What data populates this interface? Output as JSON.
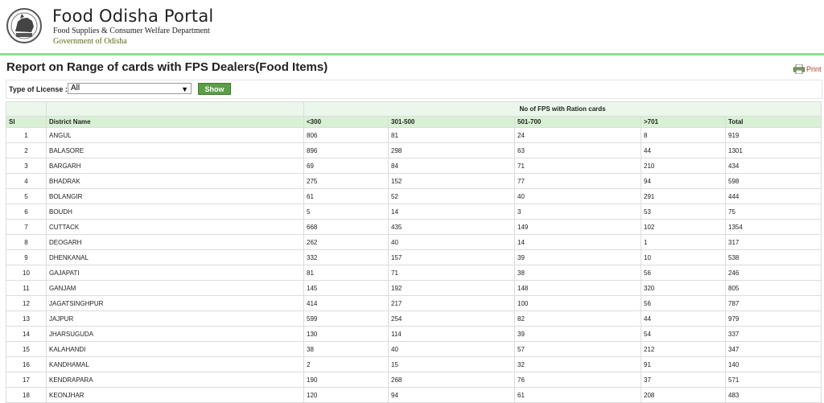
{
  "header": {
    "portal_title": "Food Odisha Portal",
    "department": "Food Supplies & Consumer Welfare Department",
    "government": "Government of Odisha"
  },
  "report": {
    "title": "Report on Range of cards with FPS Dealers(Food Items)",
    "print_label": "Print"
  },
  "filter": {
    "label": "Type of License :",
    "selected": "All",
    "show_label": "Show"
  },
  "table": {
    "group_header": "No of FPS with Ration cards",
    "columns": [
      "Sl",
      "District Name",
      "<300",
      "301-500",
      "501-700",
      ">701",
      "Total"
    ],
    "rows": [
      [
        "1",
        "ANGUL",
        "806",
        "81",
        "24",
        "8",
        "919"
      ],
      [
        "2",
        "BALASORE",
        "896",
        "298",
        "63",
        "44",
        "1301"
      ],
      [
        "3",
        "BARGARH",
        "69",
        "84",
        "71",
        "210",
        "434"
      ],
      [
        "4",
        "BHADRAK",
        "275",
        "152",
        "77",
        "94",
        "598"
      ],
      [
        "5",
        "BOLANGIR",
        "61",
        "52",
        "40",
        "291",
        "444"
      ],
      [
        "6",
        "BOUDH",
        "5",
        "14",
        "3",
        "53",
        "75"
      ],
      [
        "7",
        "CUTTACK",
        "668",
        "435",
        "149",
        "102",
        "1354"
      ],
      [
        "8",
        "DEOGARH",
        "262",
        "40",
        "14",
        "1",
        "317"
      ],
      [
        "9",
        "DHENKANAL",
        "332",
        "157",
        "39",
        "10",
        "538"
      ],
      [
        "10",
        "GAJAPATI",
        "81",
        "71",
        "38",
        "56",
        "246"
      ],
      [
        "11",
        "GANJAM",
        "145",
        "192",
        "148",
        "320",
        "805"
      ],
      [
        "12",
        "JAGATSINGHPUR",
        "414",
        "217",
        "100",
        "56",
        "787"
      ],
      [
        "13",
        "JAJPUR",
        "599",
        "254",
        "82",
        "44",
        "979"
      ],
      [
        "14",
        "JHARSUGUDA",
        "130",
        "114",
        "39",
        "54",
        "337"
      ],
      [
        "15",
        "KALAHANDI",
        "38",
        "40",
        "57",
        "212",
        "347"
      ],
      [
        "16",
        "KANDHAMAL",
        "2",
        "15",
        "32",
        "91",
        "140"
      ],
      [
        "17",
        "KENDRAPARA",
        "190",
        "268",
        "76",
        "37",
        "571"
      ],
      [
        "18",
        "KEONJHAR",
        "120",
        "94",
        "61",
        "208",
        "483"
      ]
    ]
  },
  "colors": {
    "accent_green": "#5c9e47",
    "header_rule": "#8fe08c",
    "table_header": "#d8f1d4",
    "print_red": "#c0392b"
  }
}
